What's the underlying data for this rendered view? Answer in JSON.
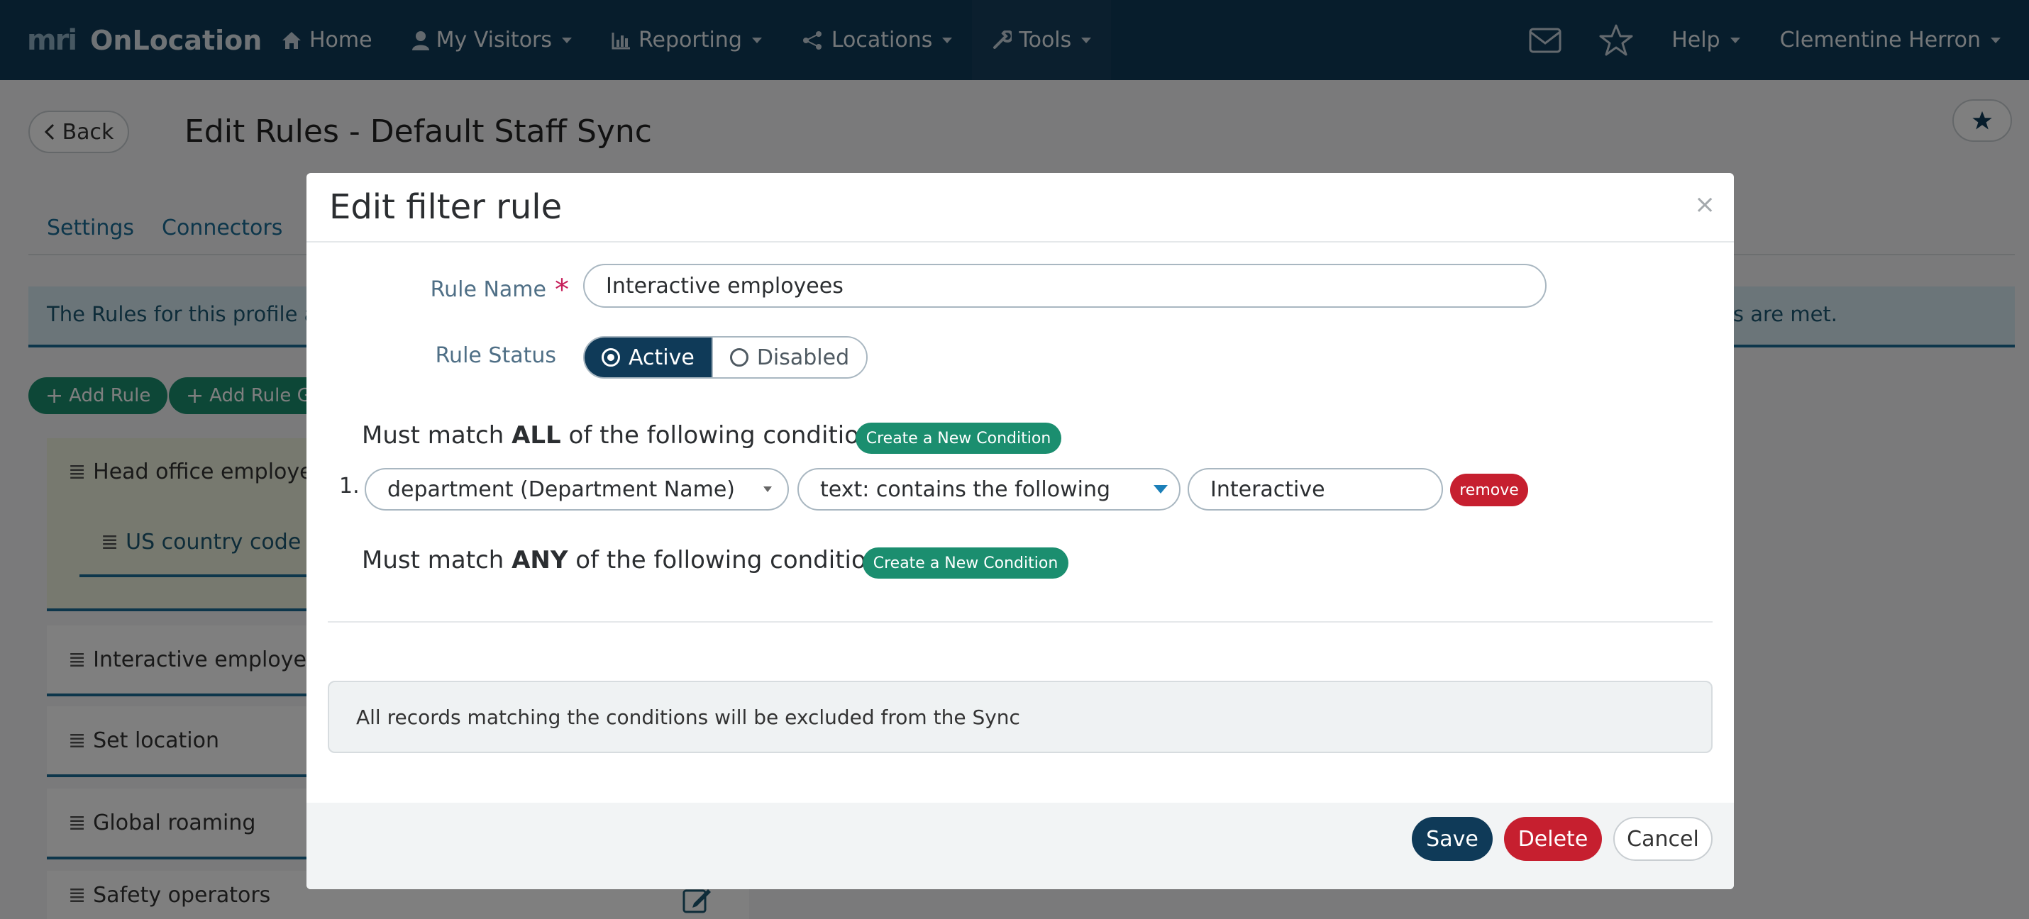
{
  "navbar": {
    "brand_logo": "mri",
    "brand_name": "OnLocation",
    "items": [
      {
        "label": "Home"
      },
      {
        "label": "My Visitors"
      },
      {
        "label": "Reporting"
      },
      {
        "label": "Locations"
      },
      {
        "label": "Tools"
      }
    ],
    "help": "Help",
    "user": "Clementine Herron"
  },
  "page": {
    "back_label": "Back",
    "title": "Edit Rules - Default Staff Sync",
    "tabs": [
      {
        "label": "Settings"
      },
      {
        "label": "Connectors"
      }
    ],
    "info_text": "The Rules for this profile are",
    "info_tail": "s are met.",
    "add_rule": "Add Rule",
    "add_rule_group": "Add Rule Gr",
    "rule_group_name": "Head office employees",
    "sub_rule_name": "US country code",
    "rules": [
      {
        "name": "Interactive employees"
      },
      {
        "name": "Set location"
      },
      {
        "name": "Global roaming"
      },
      {
        "name": "Safety operators"
      }
    ]
  },
  "modal": {
    "title": "Edit filter rule",
    "close": "×",
    "rule_name_label": "Rule Name",
    "required_mark": "*",
    "rule_name_value": "Interactive employees",
    "rule_status_label": "Rule Status",
    "status_active": "Active",
    "status_disabled": "Disabled",
    "all_prefix": "Must match",
    "all_keyword": "ALL",
    "all_suffix": "of the following conditions",
    "any_keyword": "ANY",
    "create_condition": "Create a New Condition",
    "condition": {
      "number": "1.",
      "field": "department (Department Name)",
      "operator": "text: contains the following",
      "value": "Interactive",
      "remove": "remove"
    },
    "note": "All records matching the conditions will be excluded from the Sync",
    "save": "Save",
    "delete": "Delete",
    "cancel": "Cancel"
  },
  "colors": {
    "navbar": "#0f3a58",
    "accent_green": "#1b8e6f",
    "danger": "#c61f2f",
    "primary": "#0f3a58"
  }
}
